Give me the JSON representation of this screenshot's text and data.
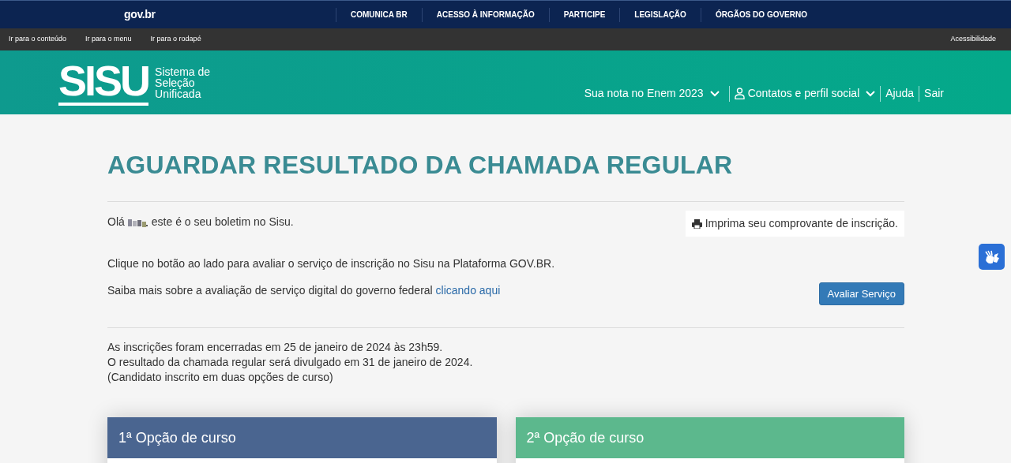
{
  "govbar": {
    "logo": "gov.br",
    "links": [
      "COMUNICA BR",
      "ACESSO À INFORMAÇÃO",
      "PARTICIPE",
      "LEGISLAÇÃO",
      "ÓRGÃOS DO GOVERNO"
    ]
  },
  "skip_bar": {
    "links": [
      "Ir para o conteúdo",
      "Ir para o menu",
      "Ir para o rodapé"
    ],
    "accessibility": "Acessibilidade"
  },
  "header": {
    "logo": "SISU",
    "logo_caption": [
      "Sistema de",
      "Seleção",
      "Unificada"
    ],
    "nav": [
      {
        "label": "Sua nota no Enem 2023",
        "kind": "dropdown"
      },
      {
        "label": "Contatos e perfil social",
        "kind": "user-dropdown"
      },
      {
        "label": "Ajuda",
        "kind": "link"
      },
      {
        "label": "Sair",
        "kind": "link"
      }
    ]
  },
  "title": "AGUARDAR RESULTADO DA CHAMADA REGULAR",
  "greeting": {
    "hello": "Olá",
    "rest": "este é o seu boletim no Sisu."
  },
  "print_link": "Imprima seu comprovante de inscrição.",
  "evaluation": {
    "text": "Clique no botão ao lado para avaliar o serviço de inscrição no Sisu na Plataforma GOV.BR.",
    "more": "Saiba mais sobre a avaliação de serviço digital do governo federal",
    "link": "clicando aqui",
    "button": "Avaliar Serviço"
  },
  "info_lines": [
    "As inscrições foram encerradas em 25 de janeiro de 2024 às 23h59.",
    "O resultado da chamada regular será divulgado em 31 de janeiro de 2024.",
    "(Candidato inscrito em duas opções de curso)"
  ],
  "options": [
    {
      "title": "1ª Opção de curso",
      "color": "#4a6590"
    },
    {
      "title": "2ª Opção de curso",
      "color": "#5cb88d"
    }
  ]
}
